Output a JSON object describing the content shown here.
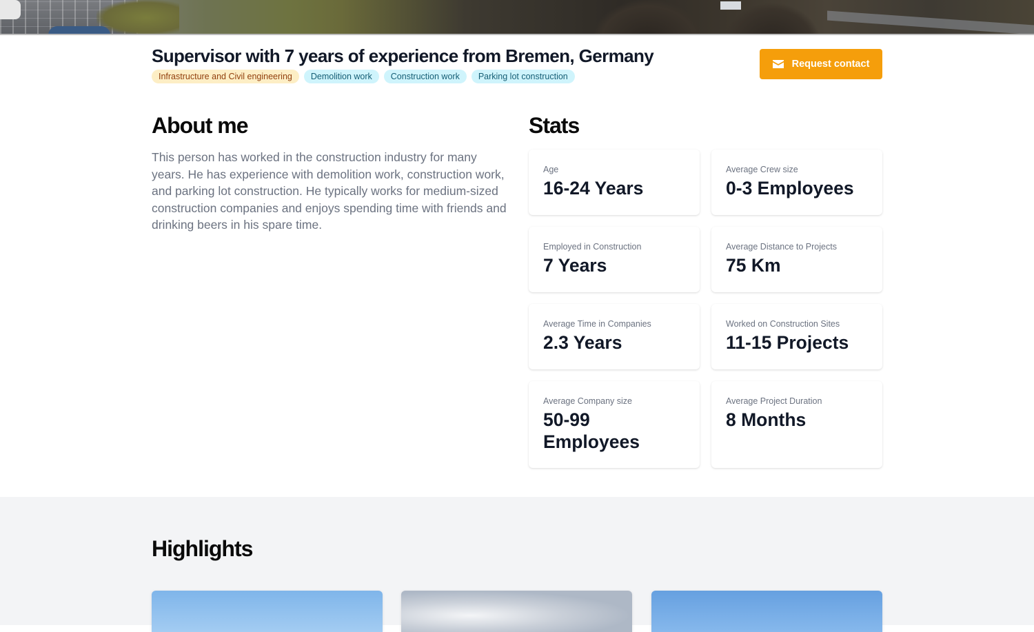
{
  "hero": {
    "image_alt": "construction site banner"
  },
  "header": {
    "title": "Supervisor with 7 years of experience from Bremen, Germany",
    "tags": [
      {
        "label": "Infrastructure and Civil engineering",
        "style": "yellow"
      },
      {
        "label": "Demolition work",
        "style": "cyan"
      },
      {
        "label": "Construction work",
        "style": "cyan"
      },
      {
        "label": "Parking lot construction",
        "style": "cyan"
      }
    ],
    "request_button": {
      "label": "Request contact",
      "icon": "envelope-icon"
    }
  },
  "about": {
    "title": "About me",
    "text": "This person has worked in the construction industry for many years. He has experience with demolition work, construction work, and parking lot construction. He typically works for medium-sized construction companies and enjoys spending time with friends and drinking beers in his spare time."
  },
  "stats": {
    "title": "Stats",
    "items": [
      {
        "label": "Age",
        "value": "16-24 Years"
      },
      {
        "label": "Average Crew size",
        "value": "0-3 Employees"
      },
      {
        "label": "Employed in Construction",
        "value": "7 Years"
      },
      {
        "label": "Average Distance to Projects",
        "value": "75 Km"
      },
      {
        "label": "Average Time in Companies",
        "value": "2.3 Years"
      },
      {
        "label": "Worked on Construction Sites",
        "value": "11-15 Projects"
      },
      {
        "label": "Average Company size",
        "value": "50-99 Employees"
      },
      {
        "label": "Average Project Duration",
        "value": "8 Months"
      }
    ]
  },
  "highlights": {
    "title": "Highlights"
  },
  "colors": {
    "accent": "#f59e0b",
    "tag_yellow_bg": "#fdeec5",
    "tag_cyan_bg": "#cff4fc",
    "section_bg": "#f3f4f6"
  }
}
